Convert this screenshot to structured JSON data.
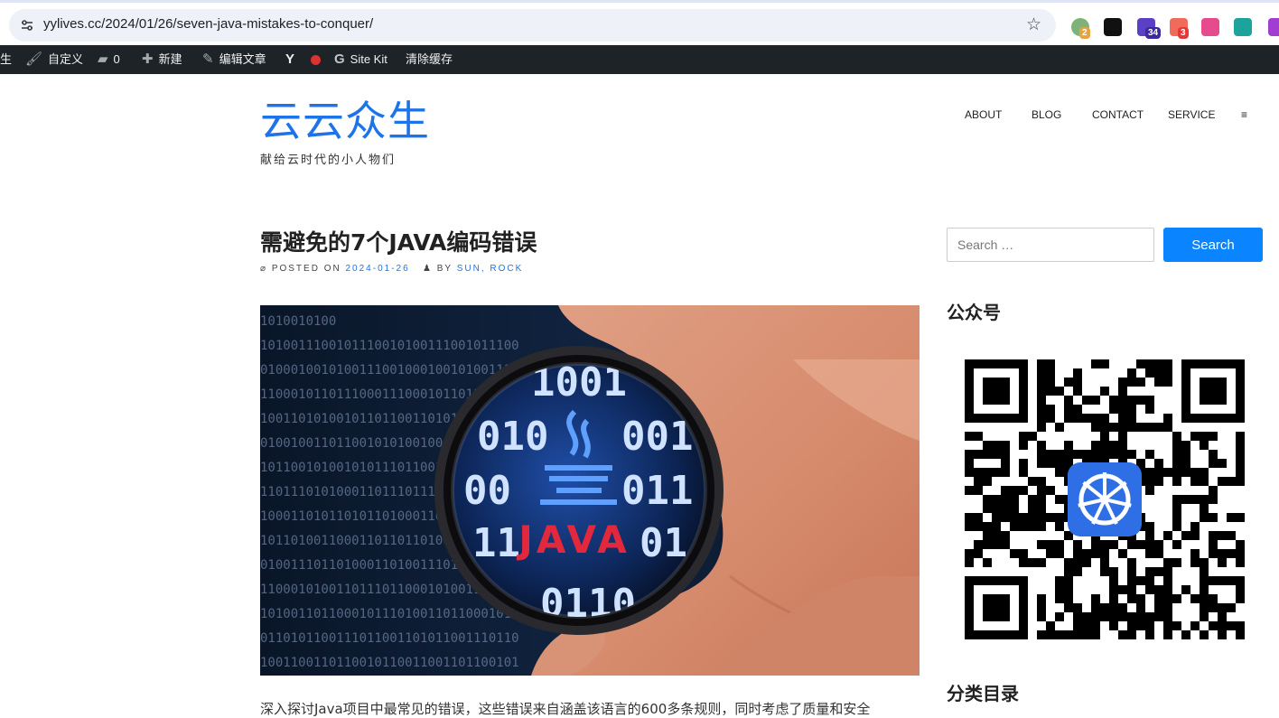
{
  "browser": {
    "url": "yylives.cc/2024/01/26/seven-java-mistakes-to-conquer/",
    "extensions": [
      {
        "name": "wechat-ext-icon",
        "badge": "2",
        "color": "#7fb27a",
        "badge_color": "#e8a33d"
      },
      {
        "name": "notion-icon",
        "badge": "",
        "color": "#111111",
        "badge_color": ""
      },
      {
        "name": "mortarboard-ext-icon",
        "badge": "34",
        "color": "#5b3fc4",
        "badge_color": "#3c2a9c"
      },
      {
        "name": "red-ext-icon",
        "badge": "3",
        "color": "#f06b5a",
        "badge_color": "#e53935"
      },
      {
        "name": "translate-ext-icon",
        "badge": "",
        "color": "#e64b8d",
        "badge_color": ""
      },
      {
        "name": "teal-ext-icon",
        "badge": "",
        "color": "#1ba39c",
        "badge_color": ""
      },
      {
        "name": "purple-ext-icon",
        "badge": "",
        "color": "#a23dd1",
        "badge_color": ""
      }
    ]
  },
  "admin_bar": {
    "site_name_fragment": "生",
    "customize": "自定义",
    "comments_count": "0",
    "new": "新建",
    "edit_post": "编辑文章",
    "yoast": "Y",
    "site_kit": "Site Kit",
    "clear_cache": "清除缓存"
  },
  "header": {
    "site_title": "云云众生",
    "tagline": "献给云时代的小人物们",
    "nav": [
      "ABOUT",
      "BLOG",
      "CONTACT",
      "SERVICE",
      "≡"
    ]
  },
  "post": {
    "title": "需避免的7个JAVA编码错误",
    "meta_posted": "POSTED ON",
    "date": "2024-01-26",
    "meta_by": "BY",
    "author": "SUN, ROCK",
    "image_binary_rows": [
      "10100",
      "10100111001011100",
      "01000100101001110",
      "11000101101110001",
      "10011010100101101",
      "01001001101100101",
      "10110010100101011",
      "11011101010001101",
      "10001101011010110",
      "10110100110001101",
      "01001110110100011",
      "11000101001101110",
      "10100110110001011",
      "01101011001110110",
      "10011001101100101"
    ],
    "image_lens_rows": [
      "1001",
      "010",
      "001",
      "00",
      "011",
      "11",
      "01",
      "0110"
    ],
    "image_lens_word": "JAVA",
    "excerpt": "深入探讨Java项目中最常见的错误，这些错误来自涵盖该语言的600多条规则，同时考虑了质量和安全"
  },
  "sidebar": {
    "search_placeholder": "Search …",
    "search_button": "Search",
    "wechat_title": "公众号",
    "categories_title": "分类目录"
  },
  "colors": {
    "brand_blue": "#1e73e8",
    "button_blue": "#0a84ff",
    "admin_bar_bg": "#1d2327"
  }
}
